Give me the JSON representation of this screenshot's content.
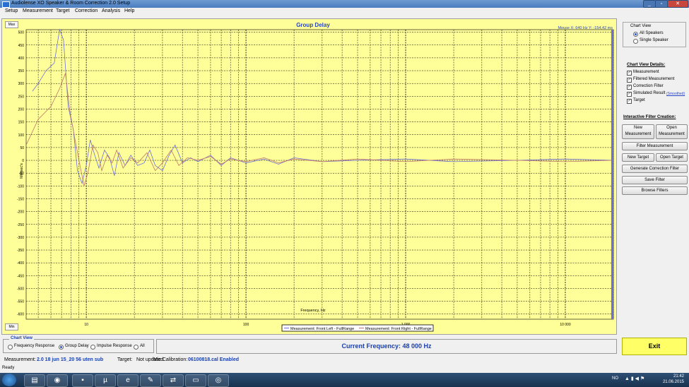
{
  "window": {
    "title": "Audiolense XO Speaker & Room Correction 2.0 Setup"
  },
  "menu": [
    "Setup",
    "Measurement",
    "Target",
    "Correction",
    "Analysis",
    "Help"
  ],
  "chart_controls": {
    "max_label": "Max",
    "min_label": "Min",
    "mouse_readout": "Mouse X: 640 Hz   Y: -154,42 ms"
  },
  "chart_data": {
    "type": "line",
    "title": "Group Delay",
    "xlabel": "Frequency, Hz",
    "ylabel": "Millisec's",
    "x_scale": "log",
    "xlim": [
      4.2,
      20000
    ],
    "ylim": [
      -620,
      510
    ],
    "x_ticks": [
      "10",
      "100",
      "1 000",
      "10 000"
    ],
    "y_ticks": [
      "500",
      "450",
      "400",
      "350",
      "300",
      "250",
      "200",
      "150",
      "100",
      "50",
      "0",
      "-50",
      "-100",
      "-150",
      "-200",
      "-250",
      "-300",
      "-350",
      "-400",
      "-450",
      "-500",
      "-550",
      "-600"
    ],
    "legend": [
      "Measurement: Front Left - FullRange",
      "Measurement: Front Right - FullRange"
    ],
    "series": [
      {
        "name": "Measurement: Front Left - FullRange",
        "color": "#6e6ed8",
        "points": [
          [
            4.6,
            270
          ],
          [
            5,
            300
          ],
          [
            5.6,
            350
          ],
          [
            6.3,
            380
          ],
          [
            6.8,
            510
          ],
          [
            7.2,
            470
          ],
          [
            7.7,
            210
          ],
          [
            8.3,
            120
          ],
          [
            8.8,
            -40
          ],
          [
            9.4,
            -90
          ],
          [
            10,
            -20
          ],
          [
            10.6,
            80
          ],
          [
            11.3,
            20
          ],
          [
            12,
            -30
          ],
          [
            13,
            40
          ],
          [
            14,
            10
          ],
          [
            15,
            -60
          ],
          [
            16,
            30
          ],
          [
            17.5,
            -20
          ],
          [
            19,
            20
          ],
          [
            21,
            -20
          ],
          [
            23,
            -10
          ],
          [
            25,
            40
          ],
          [
            27,
            -20
          ],
          [
            30,
            -40
          ],
          [
            33,
            20
          ],
          [
            36,
            60
          ],
          [
            40,
            -10
          ],
          [
            45,
            10
          ],
          [
            50,
            -5
          ],
          [
            60,
            20
          ],
          [
            70,
            -20
          ],
          [
            80,
            10
          ],
          [
            100,
            -10
          ],
          [
            130,
            5
          ],
          [
            160,
            -15
          ],
          [
            200,
            10
          ],
          [
            300,
            -5
          ],
          [
            500,
            0
          ],
          [
            1000,
            5
          ],
          [
            2000,
            -5
          ],
          [
            5000,
            0
          ],
          [
            10000,
            5
          ],
          [
            20000,
            0
          ]
        ]
      },
      {
        "name": "Measurement: Front Right - FullRange",
        "color": "#c0766c",
        "points": [
          [
            4.2,
            60
          ],
          [
            5,
            160
          ],
          [
            6,
            210
          ],
          [
            6.8,
            280
          ],
          [
            7.4,
            340
          ],
          [
            7.9,
            190
          ],
          [
            8.5,
            80
          ],
          [
            9.2,
            -30
          ],
          [
            9.7,
            -100
          ],
          [
            10.3,
            -40
          ],
          [
            11,
            60
          ],
          [
            11.8,
            30
          ],
          [
            12.5,
            -40
          ],
          [
            13.5,
            20
          ],
          [
            14.5,
            -10
          ],
          [
            15.5,
            40
          ],
          [
            17,
            -30
          ],
          [
            19,
            10
          ],
          [
            21,
            -10
          ],
          [
            24,
            30
          ],
          [
            27,
            -40
          ],
          [
            30,
            -10
          ],
          [
            34,
            40
          ],
          [
            38,
            -20
          ],
          [
            43,
            10
          ],
          [
            50,
            0
          ],
          [
            60,
            15
          ],
          [
            70,
            -15
          ],
          [
            80,
            5
          ],
          [
            100,
            -5
          ],
          [
            130,
            10
          ],
          [
            160,
            -10
          ],
          [
            200,
            5
          ],
          [
            300,
            -5
          ],
          [
            500,
            5
          ],
          [
            1000,
            -5
          ],
          [
            2000,
            5
          ],
          [
            5000,
            0
          ],
          [
            10000,
            -5
          ],
          [
            20000,
            0
          ]
        ]
      }
    ]
  },
  "right_panel": {
    "chart_view_title": "Chart View",
    "radio_options": [
      {
        "label": "All Speakers",
        "checked": true
      },
      {
        "label": "Single Speaker",
        "checked": false
      }
    ],
    "details_title": "Chart View Details:",
    "details": [
      {
        "label": "Measurement",
        "checked": true
      },
      {
        "label": "Filtered Measurement",
        "checked": true
      },
      {
        "label": "Correction Filter",
        "checked": true
      },
      {
        "label": "Simulated Result",
        "checked": true
      },
      {
        "label": "Target",
        "checked": true
      }
    ],
    "smoothed_label": "(Smoothed)",
    "filter_title": "Interactive Filter Creation:",
    "btn_new_measurement": "New Measurement",
    "btn_open_measurement": "Open Measurement",
    "btn_filter_measurement": "Filter Measurement",
    "btn_new_target": "New Target",
    "btn_open_target": "Open Target",
    "btn_generate": "Generate Correction Filter",
    "btn_save_filter": "Save Filter",
    "btn_browse_filters": "Browse Filters"
  },
  "bottom": {
    "chart_view_label": "Chart View",
    "view_options": [
      {
        "label": "Frequency Response",
        "checked": false
      },
      {
        "label": "Group Delay",
        "checked": true
      },
      {
        "label": "Impulse Response",
        "checked": false
      },
      {
        "label": "All",
        "checked": false
      }
    ],
    "current_frequency": "Current Frequency: 48 000 Hz",
    "exit_label": "Exit",
    "status": {
      "measurement_label": "Measurement:",
      "measurement_value": "2.0 18 jun 15_20 56 uten sub",
      "target_label": "Target:",
      "target_value": "Not updated",
      "mic_label": "Mic Calibration:",
      "mic_value": "06100818.cal Enabled"
    },
    "ready": "Ready"
  },
  "taskbar": {
    "icons": [
      "start-orb-icon",
      "file-explorer-icon",
      "chrome-icon",
      "app-icon",
      "utorrent-icon",
      "internet-explorer-icon",
      "tools-icon",
      "teamviewer-icon",
      "media-icon",
      "disc-icon"
    ],
    "lang": "NO",
    "time": "21:42",
    "date": "21.06.2015"
  },
  "colors": {
    "chart_bg": "#ffff99",
    "series_left": "#6e6ed8",
    "series_right": "#c0766c",
    "accent": "#1a3fa8",
    "exit_bg": "#ffff66"
  }
}
